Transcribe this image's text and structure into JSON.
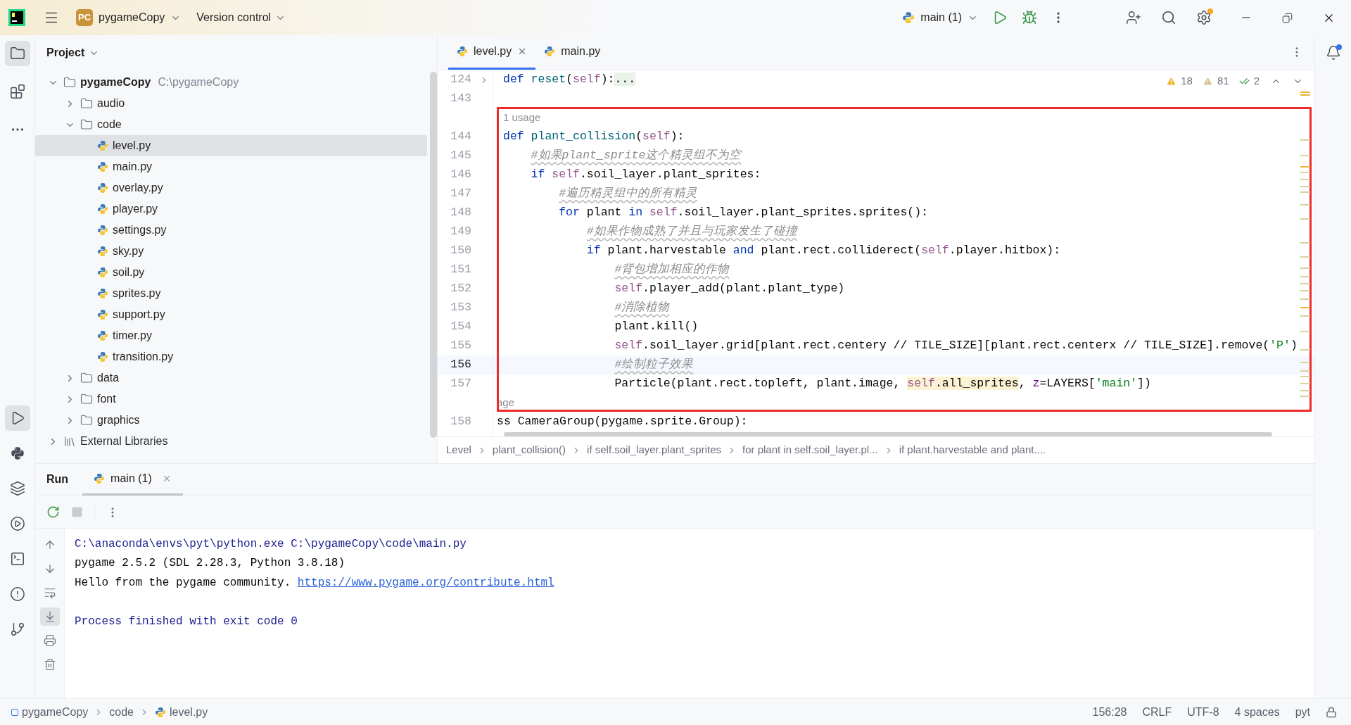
{
  "title_bar": {
    "badge": "PC",
    "project": "pygameCopy",
    "vcs": "Version control",
    "run_config": "main (1)"
  },
  "left_toolbar": {
    "top": [
      {
        "kind": "folder",
        "selected": true
      },
      {
        "kind": "structure",
        "selected": false
      },
      {
        "kind": "more",
        "selected": false
      }
    ],
    "bottom": [
      {
        "kind": "run",
        "selected": true
      },
      {
        "kind": "python",
        "selected": false
      },
      {
        "kind": "layers",
        "selected": false
      },
      {
        "kind": "services",
        "selected": false
      },
      {
        "kind": "terminal",
        "selected": false
      },
      {
        "kind": "problems",
        "selected": false
      },
      {
        "kind": "git",
        "selected": false
      }
    ]
  },
  "project": {
    "title": "Project",
    "tree": [
      {
        "label": "pygameCopy",
        "path": "C:\\pygameCopy",
        "kind": "root",
        "expanded": true,
        "selected": false,
        "children": [
          {
            "label": "audio",
            "kind": "folder",
            "expanded": false,
            "selected": false
          },
          {
            "label": "code",
            "kind": "folder",
            "expanded": true,
            "selected": false,
            "children": [
              {
                "label": "level.py",
                "kind": "python",
                "selected": true
              },
              {
                "label": "main.py",
                "kind": "python",
                "selected": false
              },
              {
                "label": "overlay.py",
                "kind": "python",
                "selected": false
              },
              {
                "label": "player.py",
                "kind": "python",
                "selected": false
              },
              {
                "label": "settings.py",
                "kind": "python",
                "selected": false
              },
              {
                "label": "sky.py",
                "kind": "python",
                "selected": false
              },
              {
                "label": "soil.py",
                "kind": "python",
                "selected": false
              },
              {
                "label": "sprites.py",
                "kind": "python",
                "selected": false
              },
              {
                "label": "support.py",
                "kind": "python",
                "selected": false
              },
              {
                "label": "timer.py",
                "kind": "python",
                "selected": false
              },
              {
                "label": "transition.py",
                "kind": "python",
                "selected": false
              }
            ]
          },
          {
            "label": "data",
            "kind": "folder",
            "expanded": false,
            "selected": false
          },
          {
            "label": "font",
            "kind": "folder",
            "expanded": false,
            "selected": false
          },
          {
            "label": "graphics",
            "kind": "folder",
            "expanded": false,
            "selected": false
          }
        ]
      },
      {
        "label": "External Libraries",
        "kind": "library",
        "expanded": false,
        "selected": false
      }
    ]
  },
  "editor": {
    "tabs": [
      {
        "label": "level.py",
        "selected": true
      },
      {
        "label": "main.py",
        "selected": false
      }
    ],
    "inspections": {
      "warnings": "18",
      "weak_warnings": "81",
      "typos": "2"
    },
    "lines": [
      {
        "kind": "code",
        "number": "124",
        "current": false,
        "folded": true,
        "tokens": [
          {
            "kind": "kw",
            "text": "def "
          },
          {
            "kind": "fn",
            "text": "reset"
          },
          {
            "kind": "plain",
            "text": "("
          },
          {
            "kind": "self",
            "text": "self"
          },
          {
            "kind": "plain",
            "text": "):"
          },
          {
            "kind": "fold",
            "text": "..."
          }
        ]
      },
      {
        "kind": "code",
        "number": "143",
        "current": false
      },
      {
        "kind": "hint",
        "text": "1 usage"
      },
      {
        "kind": "code",
        "number": "144",
        "current": false,
        "tokens": [
          {
            "kind": "kw",
            "text": "def "
          },
          {
            "kind": "fn",
            "text": "plant_collision"
          },
          {
            "kind": "plain",
            "text": "("
          },
          {
            "kind": "self",
            "text": "self"
          },
          {
            "kind": "plain",
            "text": "):"
          }
        ]
      },
      {
        "kind": "code",
        "number": "145",
        "current": false,
        "tokens": [
          {
            "kind": "comment",
            "text": "    #如果plant_sprite这个精灵组不为空"
          }
        ]
      },
      {
        "kind": "code",
        "number": "146",
        "current": false,
        "tokens": [
          {
            "kind": "kw",
            "text": "    if "
          },
          {
            "kind": "self",
            "text": "self"
          },
          {
            "kind": "plain",
            "text": ".soil_layer.plant_sprites:"
          }
        ]
      },
      {
        "kind": "code",
        "number": "147",
        "current": false,
        "tokens": [
          {
            "kind": "comment",
            "text": "        #遍历精灵组中的所有精灵"
          }
        ]
      },
      {
        "kind": "code",
        "number": "148",
        "current": false,
        "tokens": [
          {
            "kind": "kw",
            "text": "        for "
          },
          {
            "kind": "plain",
            "text": "plant "
          },
          {
            "kind": "kw",
            "text": "in "
          },
          {
            "kind": "self",
            "text": "self"
          },
          {
            "kind": "plain",
            "text": ".soil_layer.plant_sprites.sprites():"
          }
        ]
      },
      {
        "kind": "code",
        "number": "149",
        "current": false,
        "tokens": [
          {
            "kind": "comment",
            "text": "            #如果作物成熟了并且与玩家发生了碰撞"
          }
        ]
      },
      {
        "kind": "code",
        "number": "150",
        "current": false,
        "tokens": [
          {
            "kind": "kw",
            "text": "            if "
          },
          {
            "kind": "plain",
            "text": "plant.harvestable "
          },
          {
            "kind": "kw",
            "text": "and "
          },
          {
            "kind": "plain",
            "text": "plant.rect.colliderect("
          },
          {
            "kind": "self",
            "text": "self"
          },
          {
            "kind": "plain",
            "text": ".player.hitbox):"
          }
        ]
      },
      {
        "kind": "code",
        "number": "151",
        "current": false,
        "tokens": [
          {
            "kind": "comment",
            "text": "                #背包增加相应的作物"
          }
        ]
      },
      {
        "kind": "code",
        "number": "152",
        "current": false,
        "tokens": [
          {
            "kind": "self",
            "text": "                self"
          },
          {
            "kind": "plain",
            "text": ".player_add(plant.plant_type)"
          }
        ]
      },
      {
        "kind": "code",
        "number": "153",
        "current": false,
        "tokens": [
          {
            "kind": "comment",
            "text": "                #消除植物"
          }
        ]
      },
      {
        "kind": "code",
        "number": "154",
        "current": false,
        "tokens": [
          {
            "kind": "plain",
            "text": "                plant.kill()"
          }
        ]
      },
      {
        "kind": "code",
        "number": "155",
        "current": false,
        "tokens": [
          {
            "kind": "self",
            "text": "                self"
          },
          {
            "kind": "plain",
            "text": ".soil_layer.grid[plant.rect.centery // TILE_SIZE][plant.rect.centerx // TILE_SIZE].remove("
          },
          {
            "kind": "str",
            "text": "'P'"
          },
          {
            "kind": "plain",
            "text": ")"
          }
        ]
      },
      {
        "kind": "code",
        "number": "156",
        "current": true,
        "tokens": [
          {
            "kind": "comment",
            "text": "                #绘制粒子效果"
          }
        ]
      },
      {
        "kind": "code",
        "number": "157",
        "current": false,
        "tokens": [
          {
            "kind": "plain",
            "text": "                Particle(plant.rect.topleft, plant.image, "
          },
          {
            "kind": "self_match",
            "text": "self"
          },
          {
            "kind": "match",
            "text": ".all_sprites"
          },
          {
            "kind": "plain",
            "text": ", "
          },
          {
            "kind": "param",
            "text": "z"
          },
          {
            "kind": "plain",
            "text": "=LAYERS["
          },
          {
            "kind": "str",
            "text": "'main'"
          },
          {
            "kind": "plain",
            "text": "])"
          }
        ]
      },
      {
        "kind": "cut_hint",
        "text": "age"
      },
      {
        "kind": "cut_code",
        "number": "158",
        "current": false,
        "tokens": [
          {
            "kind": "plain",
            "text": "ss CameraGroup(pygame.sprite.Group):"
          }
        ]
      }
    ],
    "breadcrumbs": [
      "Level",
      "plant_collision()",
      "if self.soil_layer.plant_sprites",
      "for plant in self.soil_layer.pl...",
      "if plant.harvestable and plant...."
    ]
  },
  "run_panel": {
    "title": "Run",
    "tabs": [
      {
        "label": "main (1)",
        "selected": true
      }
    ],
    "side_tools": [
      {
        "kind": "up",
        "selected": false
      },
      {
        "kind": "down",
        "selected": false
      },
      {
        "kind": "wrap",
        "selected": false
      },
      {
        "kind": "scroll_end",
        "selected": true
      },
      {
        "kind": "print",
        "selected": false
      },
      {
        "kind": "clear",
        "selected": false
      }
    ],
    "console": [
      {
        "kind": "system",
        "text": "C:\\anaconda\\envs\\pyt\\python.exe C:\\pygameCopy\\code\\main.py"
      },
      {
        "kind": "output",
        "text": "pygame 2.5.2 (SDL 2.28.3, Python 3.8.18)"
      },
      {
        "kind": "output",
        "text": "Hello from the pygame community. ",
        "link": "https://www.pygame.org/contribute.html"
      },
      {
        "kind": "blank"
      },
      {
        "kind": "system",
        "text": "Process finished with exit code 0"
      }
    ]
  },
  "status_bar": {
    "path": [
      {
        "kind": "module",
        "label": "pygameCopy"
      },
      {
        "kind": "folder",
        "label": "code"
      },
      {
        "kind": "python",
        "label": "level.py"
      }
    ],
    "items": [
      "156:28",
      "CRLF",
      "UTF-8",
      "4 spaces",
      "pyt"
    ]
  }
}
